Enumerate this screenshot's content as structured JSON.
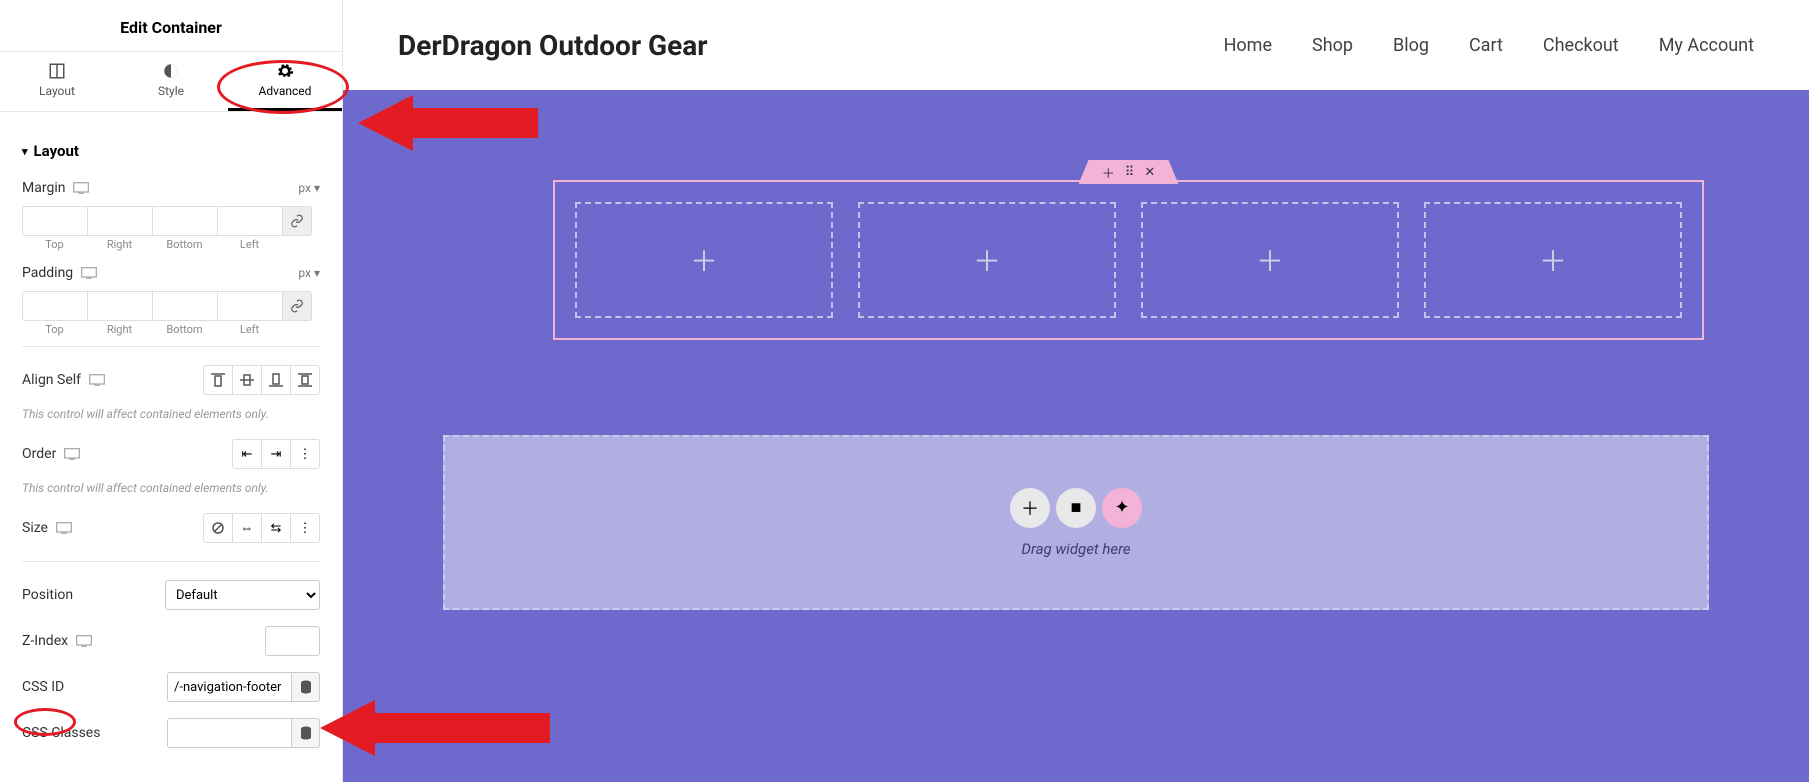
{
  "panel": {
    "title": "Edit Container",
    "tabs": {
      "layout": "Layout",
      "style": "Style",
      "advanced": "Advanced"
    },
    "section": "Layout",
    "margin_label": "Margin",
    "margin_unit": "px",
    "padding_label": "Padding",
    "padding_unit": "px",
    "sides": {
      "top": "Top",
      "right": "Right",
      "bottom": "Bottom",
      "left": "Left"
    },
    "align_self": "Align Self",
    "help1": "This control will affect contained elements only.",
    "order": "Order",
    "help2": "This control will affect contained elements only.",
    "size": "Size",
    "position": "Position",
    "position_value": "Default",
    "zindex": "Z-Index",
    "css_id": "CSS ID",
    "css_id_value": "/-navigation-footer",
    "css_classes": "CSS Classes"
  },
  "site": {
    "brand": "DerDragon Outdoor Gear",
    "nav": [
      "Home",
      "Shop",
      "Blog",
      "Cart",
      "Checkout",
      "My Account"
    ]
  },
  "dropzone": {
    "text": "Drag widget here"
  }
}
